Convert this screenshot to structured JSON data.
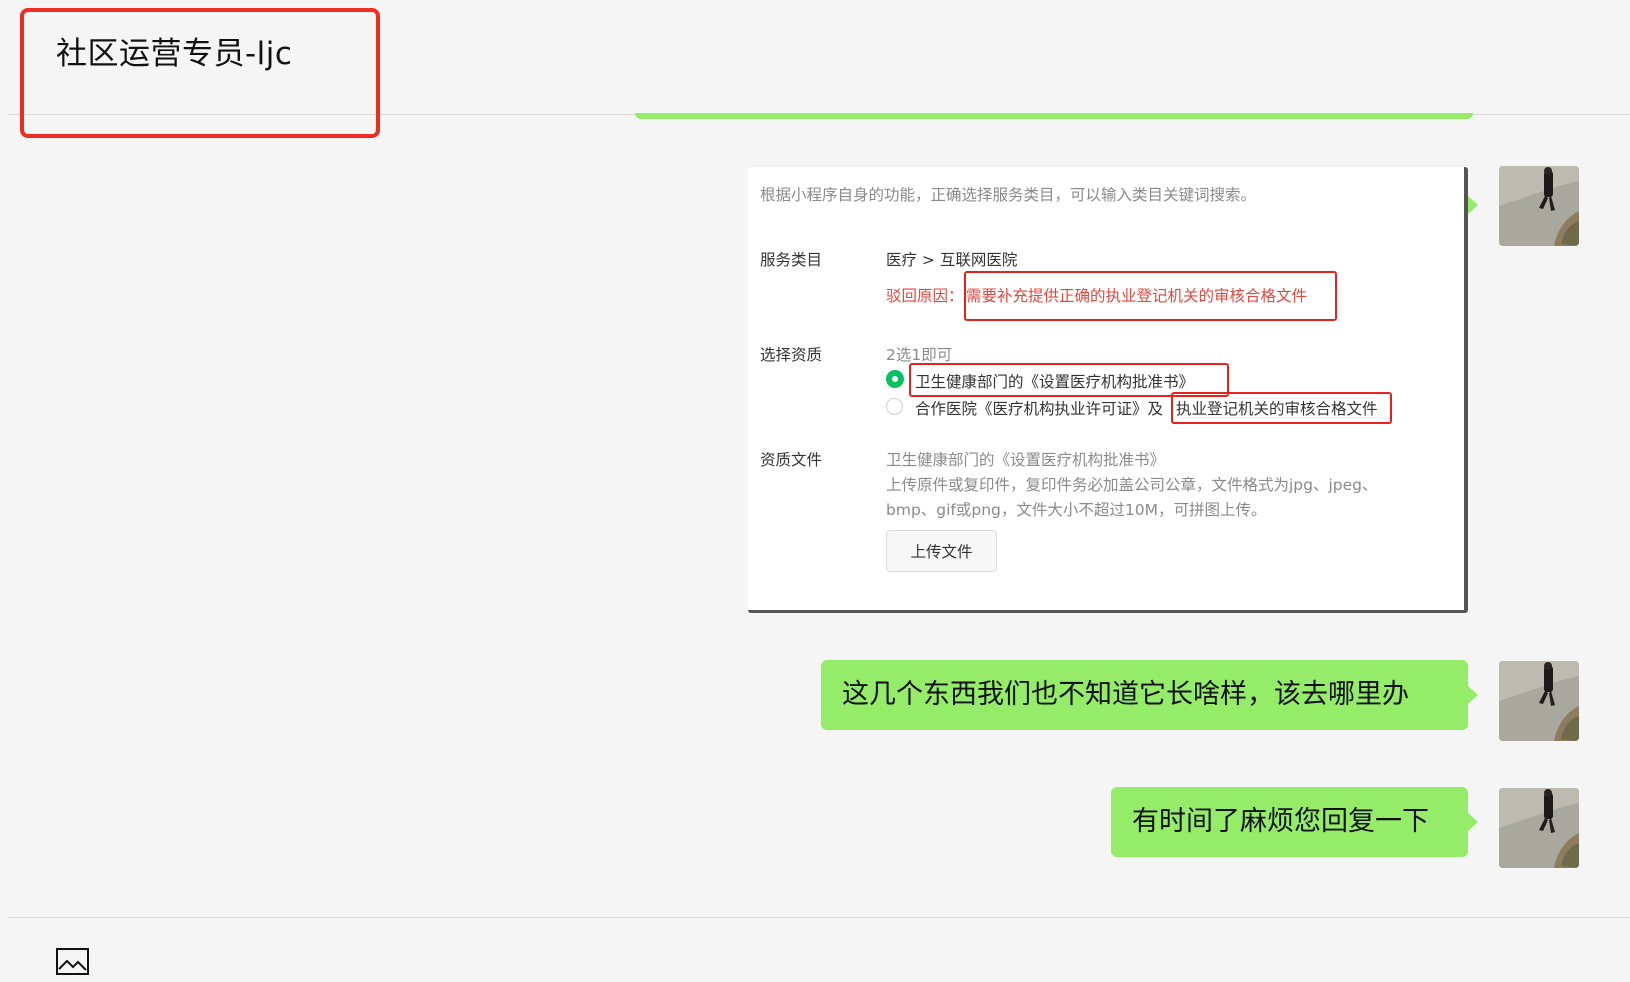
{
  "header": {
    "title": "社区运营专员-ljc"
  },
  "messages": {
    "image_card": {
      "intro": "根据小程序自身的功能，正确选择服务类目，可以输入类目关键词搜索。",
      "service_category_label": "服务类目",
      "service_category_value": "医疗 > 互联网医院",
      "reject_prefix": "驳回原因：",
      "reject_reason": "需要补充提供正确的执业登记机关的审核合格文件",
      "qualification_label": "选择资质",
      "qualification_hint": "2选1即可",
      "option1": "卫生健康部门的《设置医疗机构批准书》",
      "option2_prefix": "合作医院《医疗机构执业许可证》及",
      "option2_highlight": "执业登记机关的审核合格文件",
      "files_label": "资质文件",
      "files_title": "卫生健康部门的《设置医疗机构批准书》",
      "files_desc_line1": "上传原件或复印件，复印件务必加盖公司公章，文件格式为jpg、jpeg、",
      "files_desc_line2": "bmp、gif或png，文件大小不超过10M，可拼图上传。",
      "upload_button": "上传文件"
    },
    "text_1": "这几个东西我们也不知道它长啥样，该去哪里办",
    "text_2": "有时间了麻烦您回复一下"
  },
  "colors": {
    "bubble": "#95ec69",
    "highlight_border": "#ee2d23",
    "radio_selected": "#07c160",
    "reject_text": "#e4473c"
  },
  "icons": {
    "image_tool": "image-icon"
  }
}
